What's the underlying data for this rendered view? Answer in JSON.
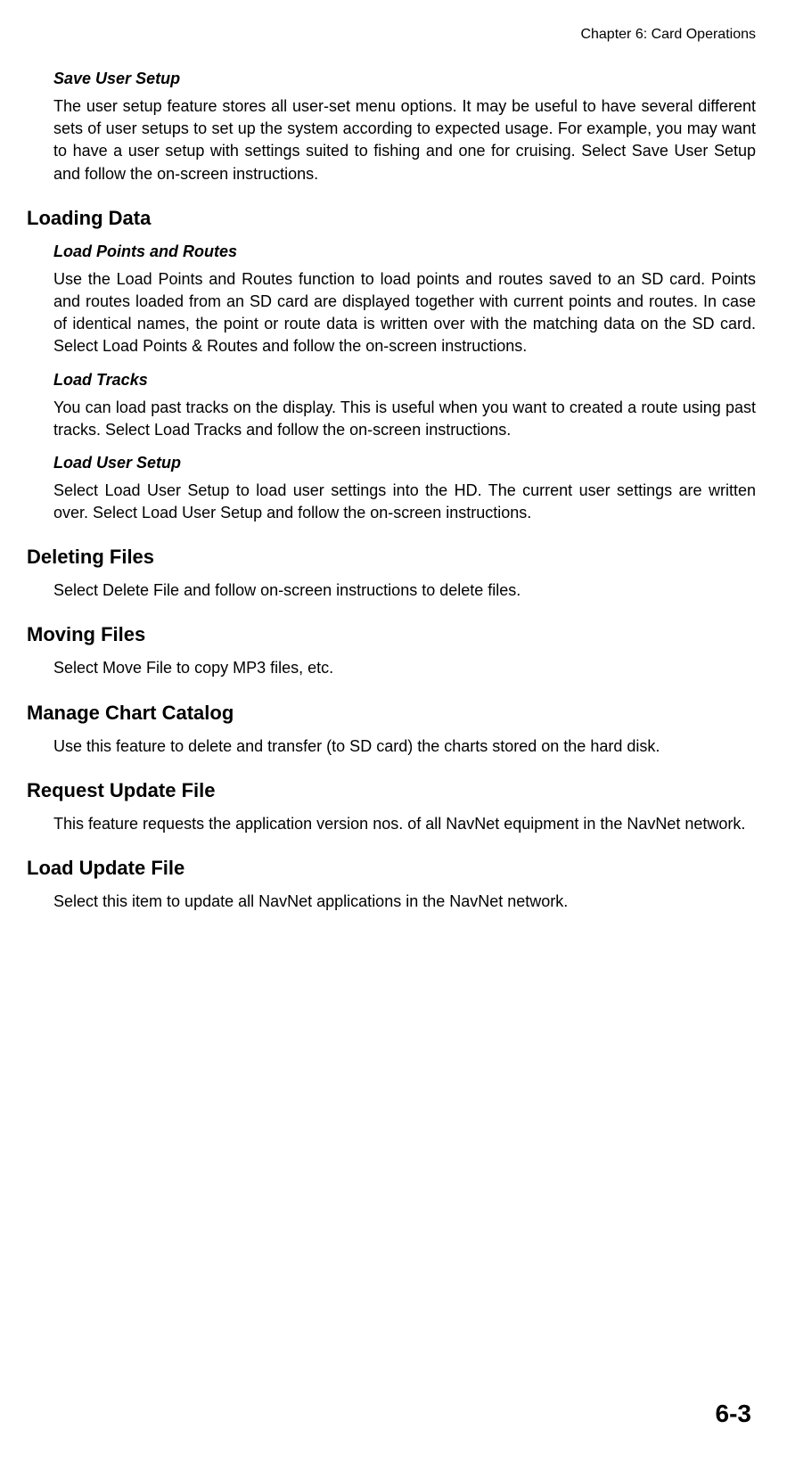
{
  "header": {
    "chapter": "Chapter 6: Card  Operations"
  },
  "sections": {
    "saveUserSetup": {
      "title": "Save User Setup",
      "body": "The user setup feature stores all user-set menu options. It may be useful to have several different sets of user setups to set up the system according to expected usage. For example, you may want to have a user setup with settings suited to fishing and one for cruising. Select Save User Setup and follow the on-screen instructions."
    },
    "loadingData": {
      "title": "Loading Data",
      "loadPointsRoutes": {
        "title": "Load Points and Routes",
        "body": "Use the Load Points and Routes function to load points and routes saved to an SD card. Points and routes loaded from an SD card are displayed together with current points and routes. In case of identical names, the point or route data is written over with the matching data on the SD card. Select Load Points & Routes and follow the on-screen instructions."
      },
      "loadTracks": {
        "title": "Load Tracks",
        "body": "You can load past tracks on the display. This is useful when you want to created a route using past tracks. Select Load Tracks and follow the on-screen instructions."
      },
      "loadUserSetup": {
        "title": "Load User Setup",
        "body": "Select Load User Setup to load user settings into the HD. The current user settings are written over. Select Load User Setup and follow the on-screen instructions."
      }
    },
    "deletingFiles": {
      "title": "Deleting Files",
      "body": "Select Delete File and follow on-screen instructions to delete files."
    },
    "movingFiles": {
      "title": "Moving Files",
      "body": "Select Move File to copy MP3 files, etc."
    },
    "manageChartCatalog": {
      "title": "Manage Chart Catalog",
      "body": "Use this feature to delete and transfer (to SD card) the charts stored on the hard disk."
    },
    "requestUpdateFile": {
      "title": "Request Update File",
      "body": "This feature requests the application version nos. of all NavNet equipment in the NavNet network."
    },
    "loadUpdateFile": {
      "title": "Load Update File",
      "body": "Select this item to update all NavNet applications in the NavNet network."
    }
  },
  "pageNumber": "6-3"
}
